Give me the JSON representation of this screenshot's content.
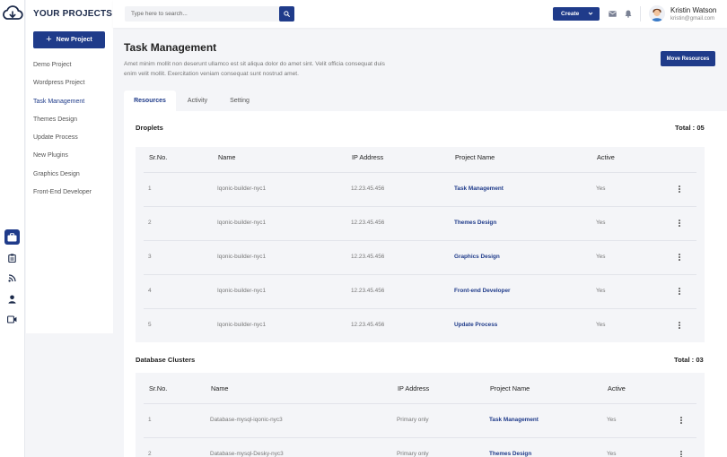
{
  "colors": {
    "accent": "#1f3b8a",
    "background": "#f4f5f8"
  },
  "rail": {
    "logo_icon": "cloud-download-icon",
    "icons": [
      "briefcase-icon",
      "clipboard-icon",
      "rss-feed-icon",
      "user-icon",
      "video-icon"
    ]
  },
  "sidebar": {
    "title": "YOUR PROJECTS",
    "new_project_label": "New Project",
    "items": [
      {
        "label": "Demo Project"
      },
      {
        "label": "Wordpress Project"
      },
      {
        "label": "Task Management"
      },
      {
        "label": "Themes Design"
      },
      {
        "label": "Update Process"
      },
      {
        "label": "New Plugins"
      },
      {
        "label": "Graphics Design"
      },
      {
        "label": "Front-End Developer"
      }
    ],
    "active_item": "Task Management"
  },
  "topbar": {
    "search_placeholder": "Type here to search...",
    "create_label": "Create",
    "user_name": "Kristin Watson",
    "user_email": "kristin@gmail.com"
  },
  "main": {
    "title": "Task Management",
    "description": "Amet minim mollit non deserunt ullamco est sit aliqua dolor do amet sint. Velit officia consequat duis enim velit mollit. Exercitation veniam consequat sunt nostrud amet.",
    "move_button_label": "Move Resources",
    "tabs": [
      {
        "label": "Resources"
      },
      {
        "label": "Activity"
      },
      {
        "label": "Setting"
      }
    ],
    "active_tab": "Resources"
  },
  "droplets": {
    "title": "Droplets",
    "total": "Total : 05",
    "columns": [
      "Sr.No.",
      "Name",
      "IP Address",
      "Project Name",
      "Active"
    ],
    "rows": [
      {
        "sr": "1",
        "name": "Iqonic-builder-nyc1",
        "ip": "12.23.45.456",
        "project": "Task Management",
        "active": "Yes"
      },
      {
        "sr": "2",
        "name": "Iqonic-builder-nyc1",
        "ip": "12.23.45.456",
        "project": "Themes Design",
        "active": "Yes"
      },
      {
        "sr": "3",
        "name": "Iqonic-builder-nyc1",
        "ip": "12.23.45.456",
        "project": "Graphics Design",
        "active": "Yes"
      },
      {
        "sr": "4",
        "name": "Iqonic-builder-nyc1",
        "ip": "12.23.45.456",
        "project": "Front-end Developer",
        "active": "Yes"
      },
      {
        "sr": "5",
        "name": "Iqonic-builder-nyc1",
        "ip": "12.23.45.456",
        "project": "Update Process",
        "active": "Yes"
      }
    ]
  },
  "clusters": {
    "title": "Database Clusters",
    "total": "Total : 03",
    "columns": [
      "Sr.No.",
      "Name",
      "IP Address",
      "Project Name",
      "Active"
    ],
    "rows": [
      {
        "sr": "1",
        "name": "Database-mysql-iqonic-nyc3",
        "ip": "Primary only",
        "project": "Task Management",
        "active": "Yes"
      },
      {
        "sr": "2",
        "name": "Database-mysql-Desky-nyc3",
        "ip": "Primary only",
        "project": "Themes Design",
        "active": "Yes"
      }
    ]
  }
}
